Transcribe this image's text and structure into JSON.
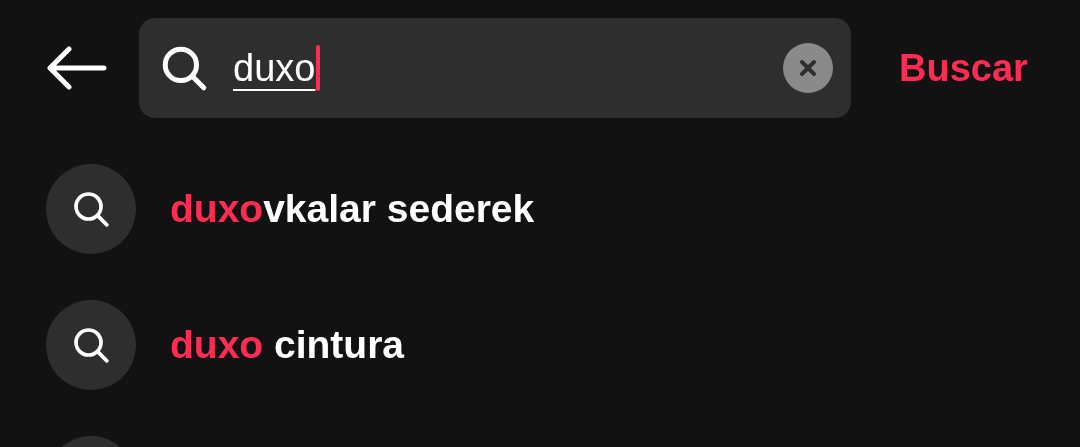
{
  "search": {
    "value": "duxo",
    "submit": "Buscar"
  },
  "suggestions": [
    {
      "match": "duxo",
      "rest": "vkalar sederek"
    },
    {
      "match": "duxo",
      "rest": " cintura"
    }
  ]
}
